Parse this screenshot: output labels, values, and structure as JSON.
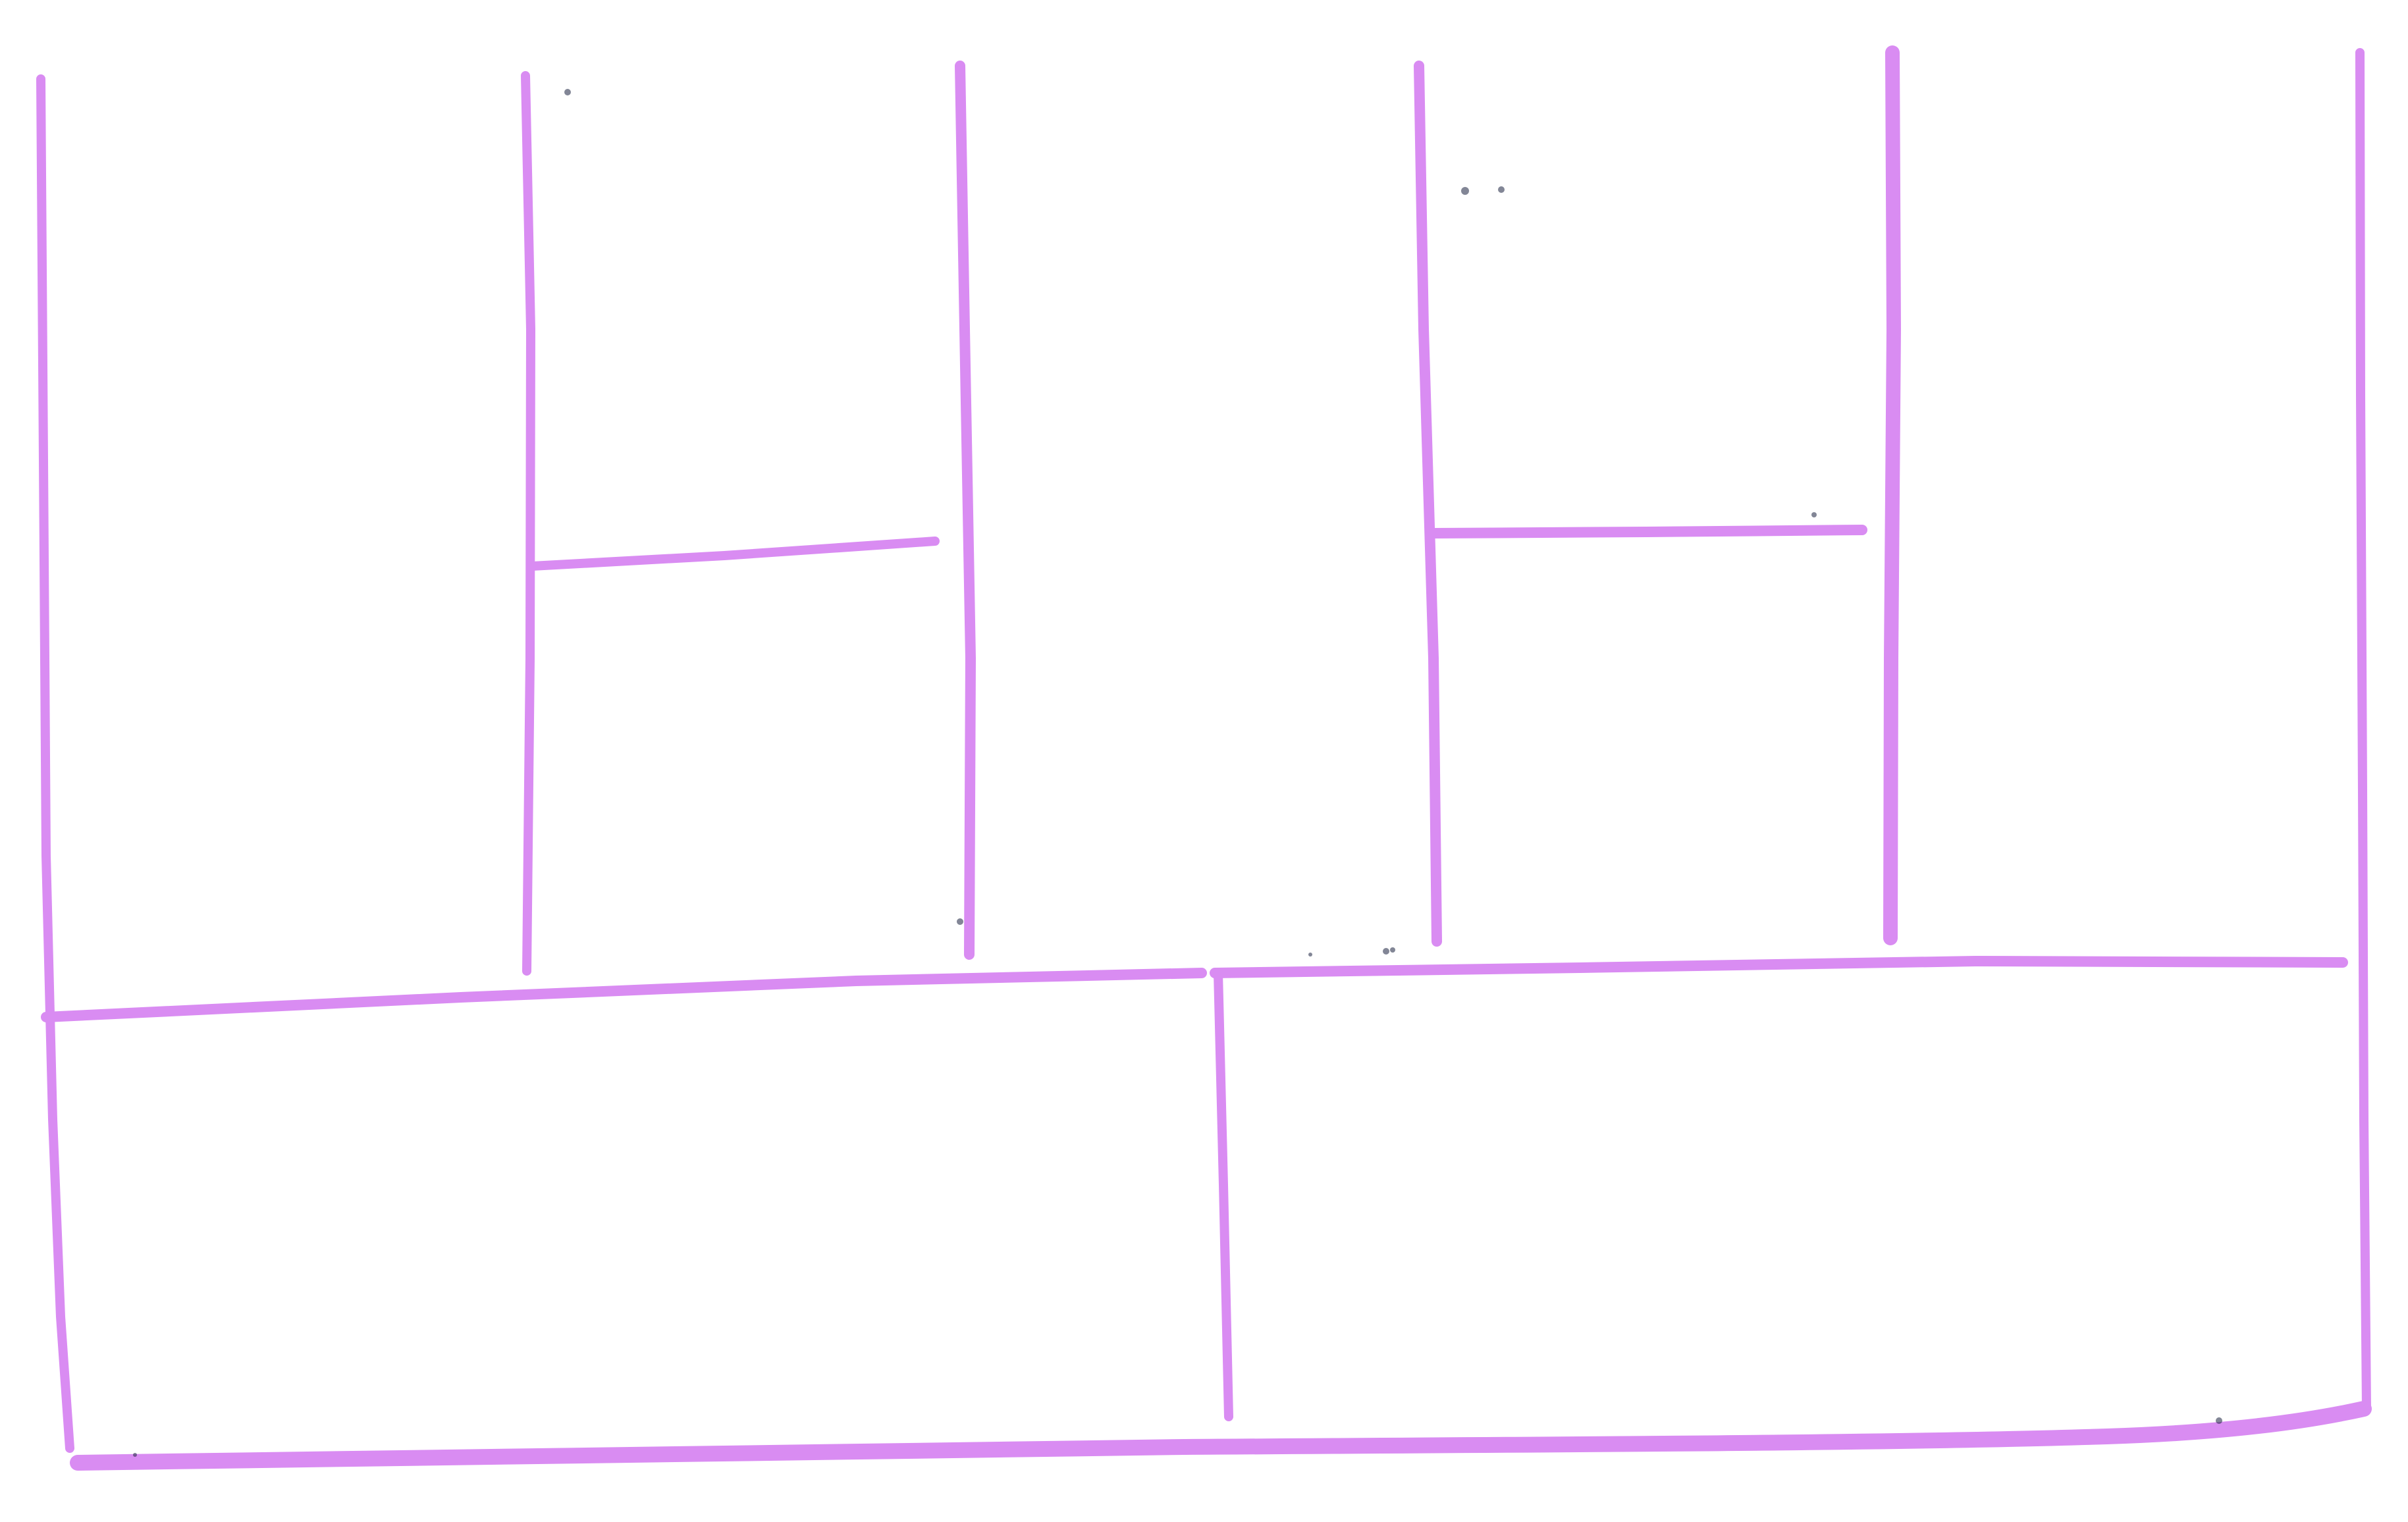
{
  "diagram": {
    "kind": "hand-drawn-grid-template",
    "text_content": [],
    "grid": {
      "top_band_cells": 7,
      "top_band_columns": 5,
      "split_columns": [
        2,
        4
      ],
      "bottom_band_cells": 2
    },
    "colors": {
      "background": "#ffffff",
      "line": "#d98cf2",
      "speck": "#1c2340"
    }
  }
}
